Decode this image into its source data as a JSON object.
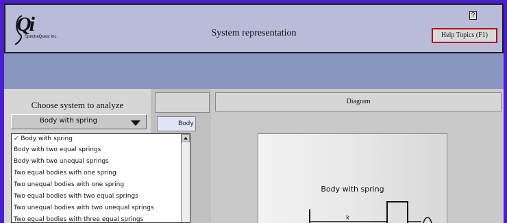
{
  "header": {
    "logo_text": "Qi",
    "logo_subtext": "SpectraQuest Inc.",
    "title": "System representation",
    "help_icon": "?",
    "help_button_label": "Help Topics (F1)"
  },
  "left_panel": {
    "choose_label": "Choose system to analyze",
    "selected_value": "Body with spring",
    "options": [
      "✓ Body with spring",
      "Body with two equal springs",
      "Body with two unequal springs",
      "Two equal bodies with one spring",
      "Two unequal bodies with one spring",
      "Two equal bodies with two equal springs",
      "Two unequal bodies with two unequal springs",
      "Two equal bodies with three equal springs"
    ]
  },
  "mid_panel": {
    "cell_text": "Body"
  },
  "diagram": {
    "header": "Diagram",
    "title": "Body with spring",
    "spring_label": "k"
  },
  "icons": [
    "logo-icon",
    "help-icon",
    "dropdown-arrow-icon",
    "scroll-up-icon"
  ]
}
